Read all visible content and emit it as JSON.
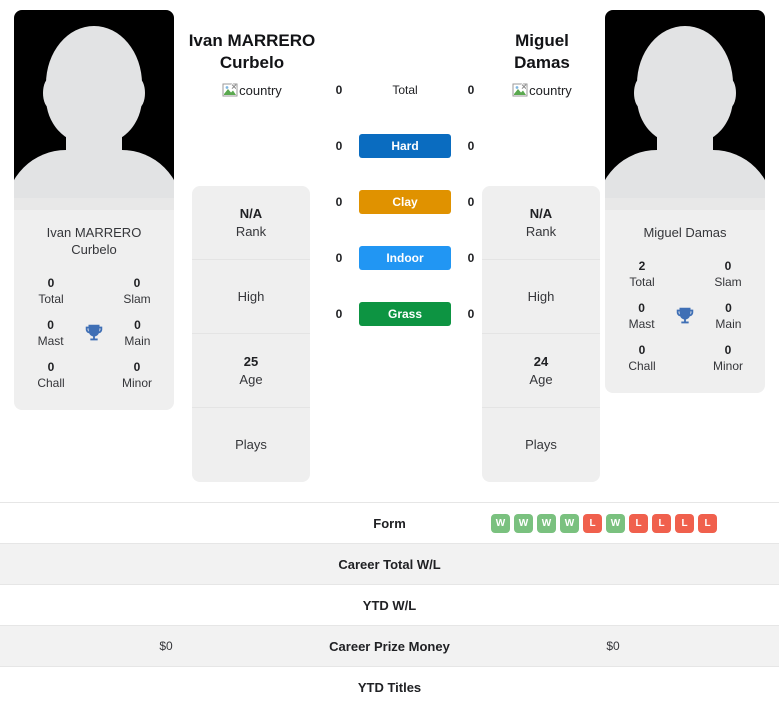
{
  "players": {
    "left": {
      "display_name_line1": "Ivan MARRERO",
      "display_name_line2": "Curbelo",
      "card_name_line1": "Ivan MARRERO",
      "card_name_line2": "Curbelo",
      "country_alt": "country",
      "titles": {
        "total_value": "0",
        "total_label": "Total",
        "slam_value": "0",
        "slam_label": "Slam",
        "mast_value": "0",
        "mast_label": "Mast",
        "main_value": "0",
        "main_label": "Main",
        "chall_value": "0",
        "chall_label": "Chall",
        "minor_value": "0",
        "minor_label": "Minor"
      },
      "info": {
        "rank_value": "N/A",
        "rank_label": "Rank",
        "high_value": "",
        "high_label": "High",
        "age_value": "25",
        "age_label": "Age",
        "plays_value": "",
        "plays_label": "Plays"
      },
      "prize_money": "$0"
    },
    "right": {
      "display_name_line1": "Miguel",
      "display_name_line2": "Damas",
      "card_name_line1": "Miguel Damas",
      "card_name_line2": "",
      "country_alt": "country",
      "titles": {
        "total_value": "2",
        "total_label": "Total",
        "slam_value": "0",
        "slam_label": "Slam",
        "mast_value": "0",
        "mast_label": "Mast",
        "main_value": "0",
        "main_label": "Main",
        "chall_value": "0",
        "chall_label": "Chall",
        "minor_value": "0",
        "minor_label": "Minor"
      },
      "info": {
        "rank_value": "N/A",
        "rank_label": "Rank",
        "high_value": "",
        "high_label": "High",
        "age_value": "24",
        "age_label": "Age",
        "plays_value": "",
        "plays_label": "Plays"
      },
      "prize_money": "$0"
    }
  },
  "surfaces": [
    {
      "label": "Total",
      "left": "0",
      "right": "0",
      "color": ""
    },
    {
      "label": "Hard",
      "left": "0",
      "right": "0",
      "color": "#0a6cc0"
    },
    {
      "label": "Clay",
      "left": "0",
      "right": "0",
      "color": "#e09200"
    },
    {
      "label": "Indoor",
      "left": "0",
      "right": "0",
      "color": "#2196f3"
    },
    {
      "label": "Grass",
      "left": "0",
      "right": "0",
      "color": "#0d9442"
    }
  ],
  "table": {
    "form": {
      "label": "Form",
      "left_values": [],
      "right_values": [
        "W",
        "W",
        "W",
        "W",
        "L",
        "W",
        "L",
        "L",
        "L",
        "L"
      ]
    },
    "career_total_wl": {
      "label": "Career Total W/L",
      "left": "",
      "right": ""
    },
    "ytd_wl": {
      "label": "YTD W/L",
      "left": "",
      "right": ""
    },
    "career_prize_money": {
      "label": "Career Prize Money",
      "left": "$0",
      "right": "$0"
    },
    "ytd_titles": {
      "label": "YTD Titles",
      "left": "",
      "right": ""
    }
  },
  "colors": {
    "win": "#7ac17f",
    "loss": "#f0604d",
    "trophy": "#3f6fb5",
    "card_bg": "#efefef",
    "stripe_bg": "#f2f2f2"
  }
}
